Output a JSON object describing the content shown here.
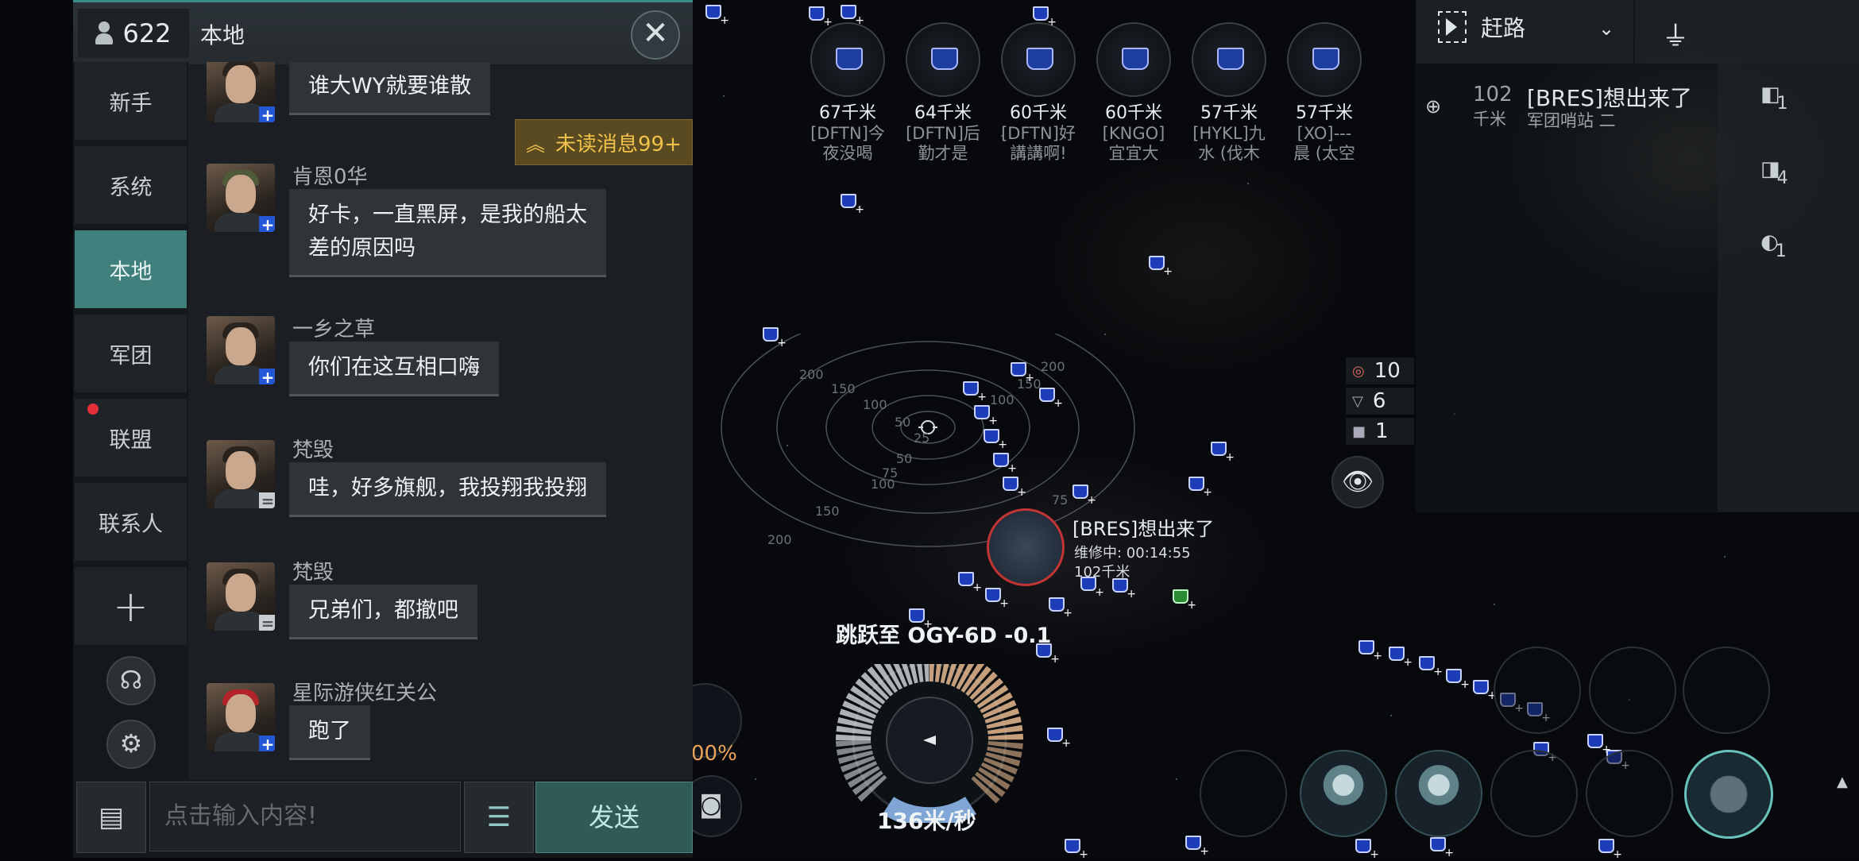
{
  "chat": {
    "member_count": "622",
    "channel_title": "本地",
    "tabs": [
      "新手",
      "系统",
      "本地",
      "军团",
      "联盟",
      "联系人"
    ],
    "active_tab": "本地",
    "unread_label": "未读消息99+",
    "messages": [
      {
        "sender": "",
        "text": "谁大WY就要谁散",
        "badge": "+"
      },
      {
        "sender": "肯恩0华",
        "text_line1": "好卡，一直黑屏，是我的船太",
        "text_line2": "差的原因吗",
        "badge": "+"
      },
      {
        "sender": "一乡之草",
        "text": "你们在这互相口嗨",
        "badge": "+"
      },
      {
        "sender": "梵毁",
        "text": "哇，好多旗舰，我投翔我投翔",
        "badge": "="
      },
      {
        "sender": "梵毁",
        "text": "兄弟们，都撤吧",
        "badge": "="
      },
      {
        "sender": "星际游侠红关公",
        "text": "跑了",
        "badge": "+"
      }
    ],
    "input_placeholder": "点击输入内容!",
    "send_label": "发送"
  },
  "targets": [
    {
      "distance": "67千米",
      "name_line1": "[DFTN]今",
      "name_line2": "夜没喝"
    },
    {
      "distance": "64千米",
      "name_line1": "[DFTN]后",
      "name_line2": "勤才是"
    },
    {
      "distance": "60千米",
      "name_line1": "[DFTN]好",
      "name_line2": "講講啊!"
    },
    {
      "distance": "60千米",
      "name_line1": "[KNGO]",
      "name_line2": "宜宜大"
    },
    {
      "distance": "57千米",
      "name_line1": "[HYKL]九",
      "name_line2": "水 (伐木"
    },
    {
      "distance": "57千米",
      "name_line1": "[XO]---",
      "name_line2": "晨 (太空"
    }
  ],
  "overview": {
    "preset": "赶路",
    "row": {
      "distance": "102",
      "unit": "千米",
      "name": "[BRES]想出来了",
      "sub": "军团哨站 二"
    },
    "side_counts": [
      "1",
      "4",
      "1"
    ]
  },
  "counters": [
    {
      "icon": "target-count-icon",
      "value": "10"
    },
    {
      "icon": "drone-count-icon",
      "value": "6"
    },
    {
      "icon": "structure-count-icon",
      "value": "1"
    }
  ],
  "radar_labels": [
    "200",
    "150",
    "100",
    "50",
    "25",
    "50",
    "75",
    "100",
    "150",
    "200",
    "200",
    "150",
    "100",
    "75"
  ],
  "selected": {
    "name": "[BRES]想出来了",
    "repair": "维修中: 00:14:55",
    "distance": "102千米"
  },
  "jump_text": "跳跃至 OGY-6D -0.1",
  "hud": {
    "speed": "136米/秒",
    "percent": "00%"
  },
  "colors": {
    "accent": "#3f7f7c",
    "unread": "#f1c24a",
    "hostile_ring": "#c23534",
    "blip": "#1d3cb8"
  }
}
